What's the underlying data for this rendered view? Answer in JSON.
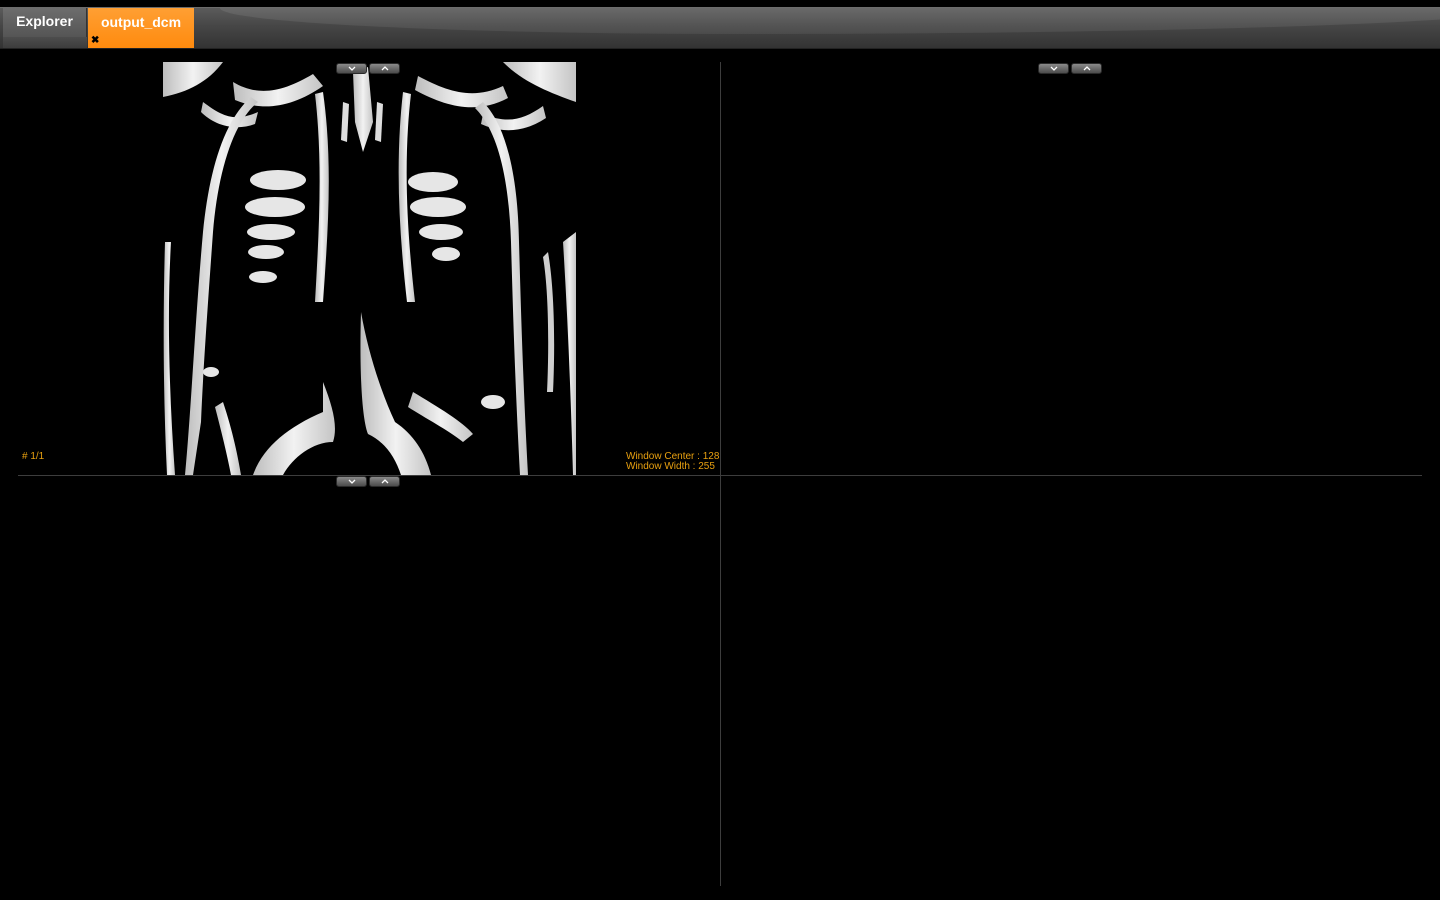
{
  "tabs": [
    {
      "label": "Explorer",
      "active": false
    },
    {
      "label": "output_dcm",
      "active": true,
      "close_icon": "close-icon"
    }
  ],
  "viewer": {
    "top_left": {
      "frame_counter": "# 1/1",
      "window_center": "Window Center : 128",
      "window_width": "Window Width : 255",
      "image": "chest-xray-coronal-dicom",
      "nav_icons": [
        "chevron-down-icon",
        "chevron-up-icon"
      ]
    },
    "top_right": {
      "nav_icons": [
        "chevron-down-icon",
        "chevron-up-icon"
      ]
    },
    "bottom_left": {
      "nav_icons": [
        "chevron-down-icon",
        "chevron-up-icon"
      ]
    }
  },
  "colors": {
    "active_tab": "#ff9414",
    "overlay_text": "#e8a010",
    "background": "#000000"
  }
}
